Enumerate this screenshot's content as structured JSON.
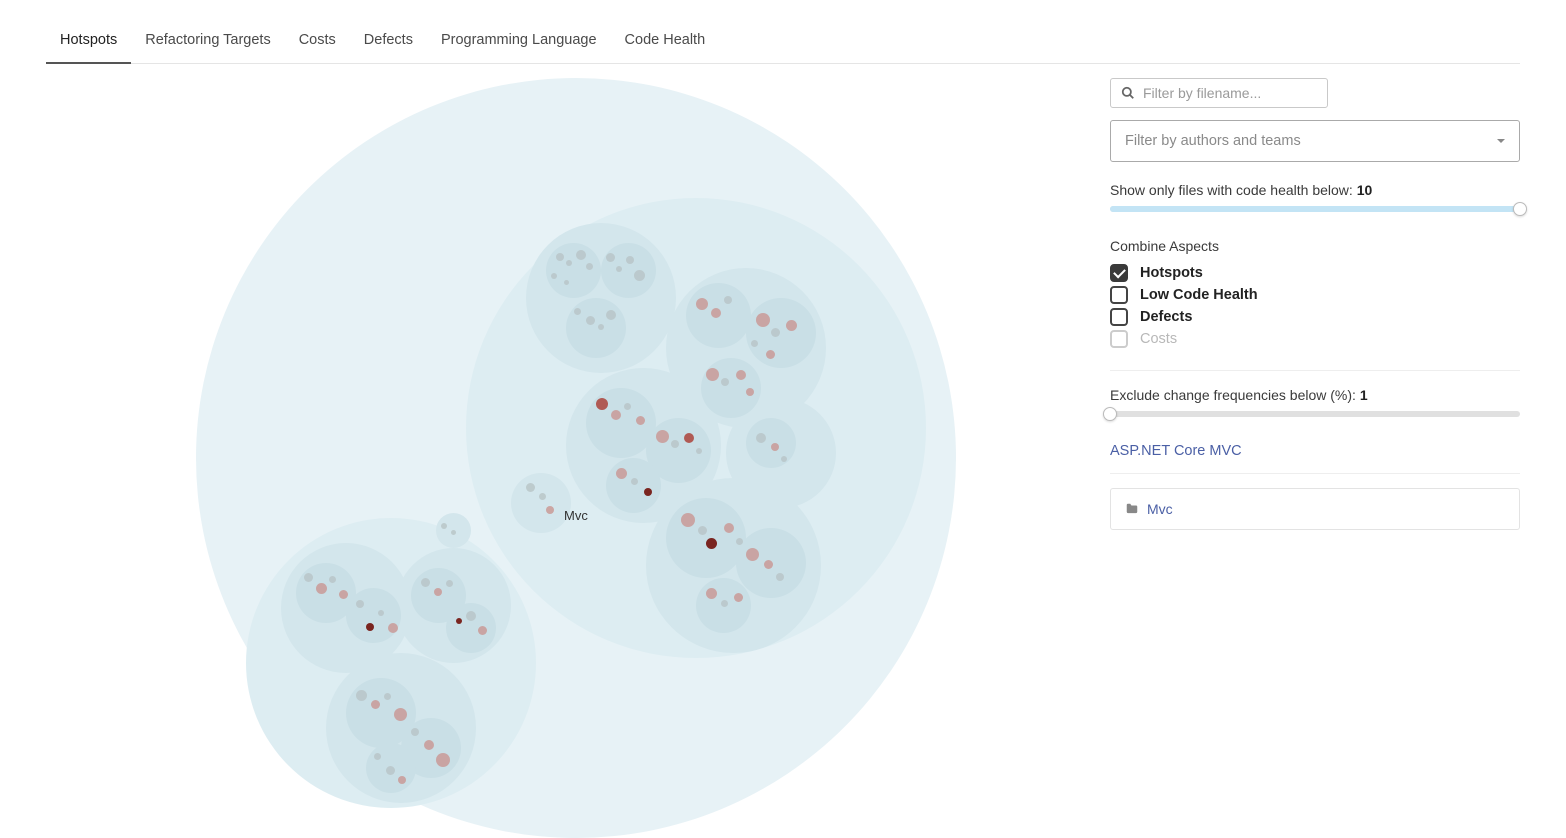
{
  "tabs": {
    "hotspots": "Hotspots",
    "refactoring": "Refactoring Targets",
    "costs": "Costs",
    "defects": "Defects",
    "prog_lang": "Programming Language",
    "code_health": "Code Health"
  },
  "search": {
    "placeholder": "Filter by filename..."
  },
  "authors_select": {
    "placeholder": "Filter by authors and teams"
  },
  "health_slider": {
    "label_prefix": "Show only files with code health below: ",
    "value": "10"
  },
  "combine": {
    "title": "Combine Aspects",
    "hotspots": "Hotspots",
    "low_code_health": "Low Code Health",
    "defects": "Defects",
    "costs": "Costs"
  },
  "freq_slider": {
    "label_prefix": "Exclude change frequencies below (%): ",
    "value": "1"
  },
  "breadcrumb": {
    "root": "ASP.NET Core MVC"
  },
  "folder": {
    "name": "Mvc"
  },
  "viz": {
    "label": "Mvc"
  }
}
